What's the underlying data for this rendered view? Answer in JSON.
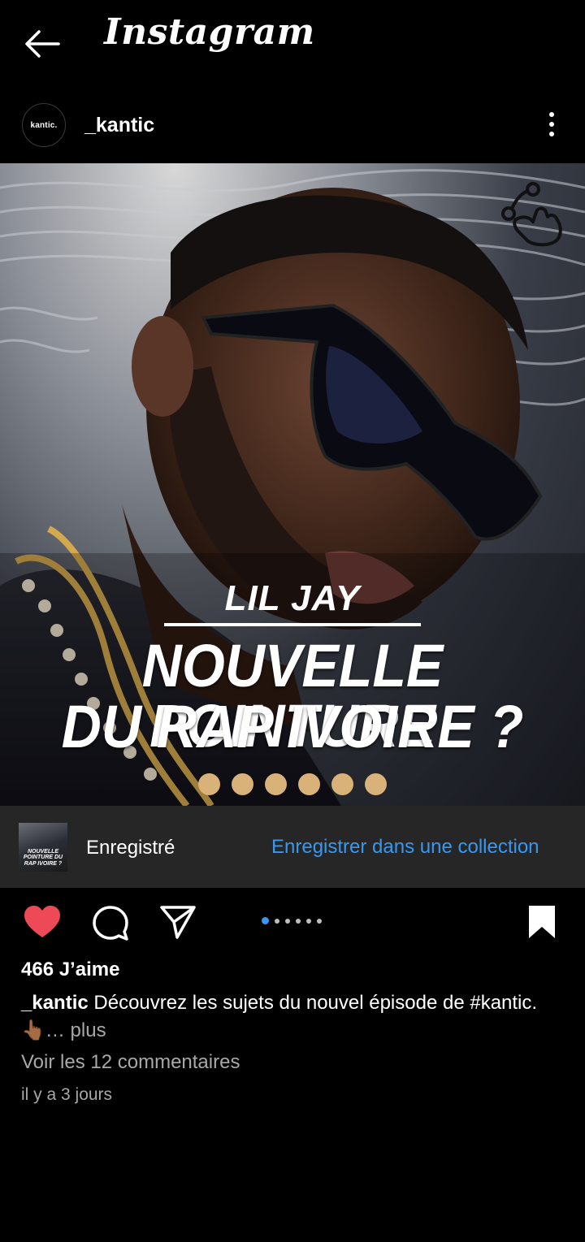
{
  "app": {
    "brand": "Instagram"
  },
  "post": {
    "username": "_kantic",
    "avatar_text": "kantic.",
    "media": {
      "subtitle": "LIL JAY",
      "headline_line1": "NOUVELLE POINTURE",
      "headline_line2": "DU RAP IVOIRE ?",
      "slide_count": 6,
      "dot_color": "#d9b27a"
    },
    "saved_bar": {
      "status": "Enregistré",
      "action": "Enregistrer dans une collection",
      "thumb_text": "NOUVELLE POINTURE DU RAP IVOIRE ?"
    },
    "carousel": {
      "total": 6,
      "active_index": 0
    },
    "likes": "466 J’aime",
    "caption": {
      "author": "_kantic",
      "text": "Découvrez les sujets du nouvel épisode de #kantic. 👆🏾",
      "more": "… plus"
    },
    "view_comments": "Voir les 12 commentaires",
    "timestamp": "il y a 3 jours"
  },
  "colors": {
    "accent_blue": "#3897f0",
    "like_red": "#ed4956",
    "saved_bar_bg": "#262626"
  }
}
